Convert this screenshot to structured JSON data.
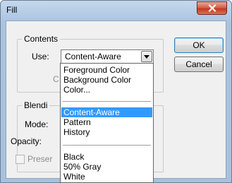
{
  "window": {
    "title": "Fill"
  },
  "contents": {
    "legend": "Contents",
    "use_label": "Use:",
    "use_value": "Content-Aware",
    "custom_label_fragment": "C"
  },
  "blending": {
    "legend_fragment": "Blendi",
    "mode_label": "Mode:",
    "opacity_label": "Opacity:",
    "preserve_label_fragment": "Preser"
  },
  "buttons": {
    "ok": "OK",
    "cancel": "Cancel"
  },
  "dropdown": {
    "groups": [
      [
        "Foreground Color",
        "Background Color",
        "Color..."
      ],
      [
        "Content-Aware",
        "Pattern",
        "History"
      ],
      [
        "Black",
        "50% Gray",
        "White"
      ]
    ],
    "selected": "Content-Aware"
  },
  "colors": {
    "highlight": "#3399ff",
    "close_button": "#c23a1f",
    "dialog_face": "#f0f0f0",
    "frame": "#aac4e0"
  }
}
